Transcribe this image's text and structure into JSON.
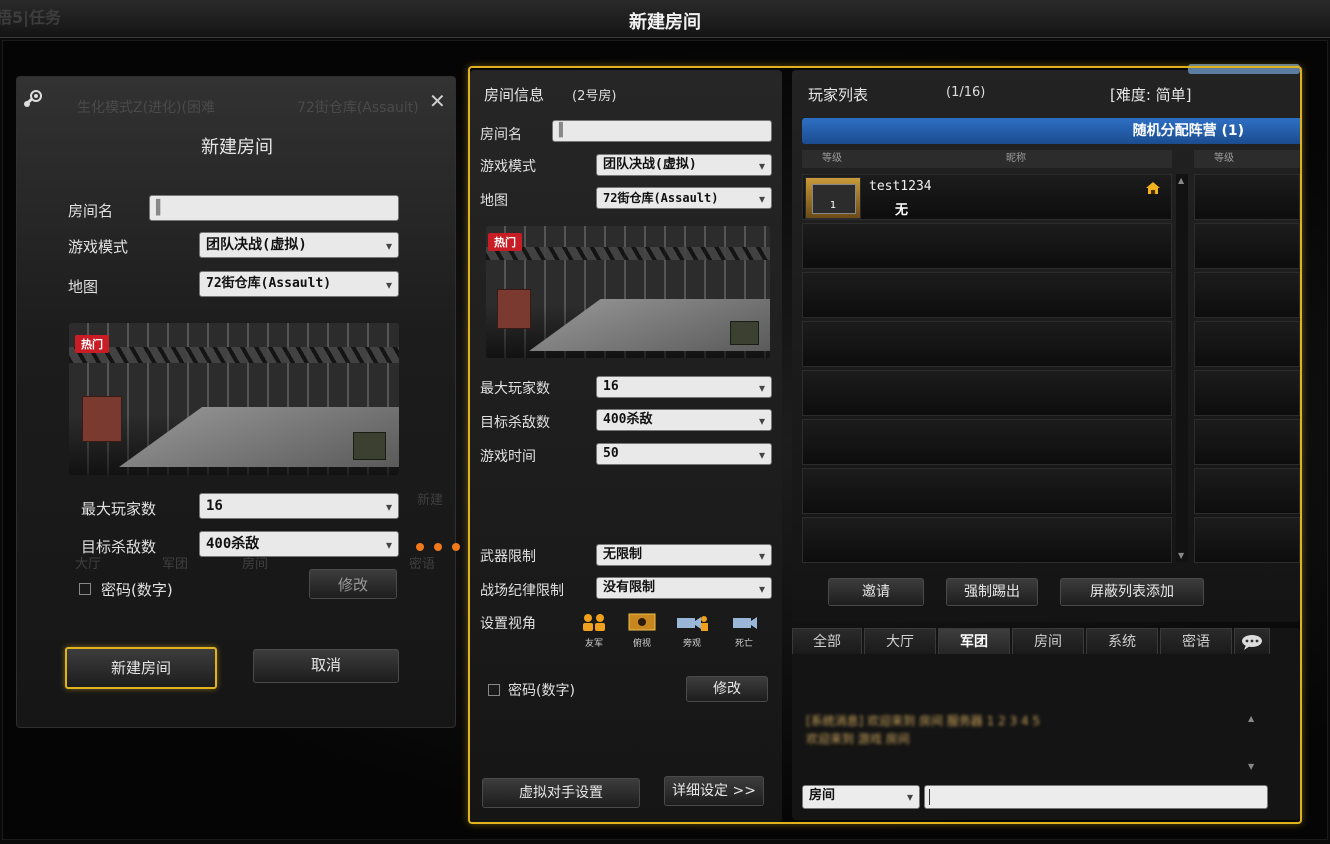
{
  "window": {
    "title": "新建房间",
    "ghost_left": "梧5|任务"
  },
  "dialog": {
    "ghost_mode": "生化模式Z(进化)(困难",
    "ghost_map": "72街仓库(Assault)",
    "title": "新建房间",
    "room_name_label": "房间名",
    "room_name_value": "▌",
    "mode_label": "游戏模式",
    "mode_value": "团队决战(虚拟)",
    "map_label": "地图",
    "map_value": "72街仓库(Assault)",
    "hot_badge": "热门",
    "max_players_label": "最大玩家数",
    "max_players_value": "16",
    "target_kills_label": "目标杀敌数",
    "target_kills_value": "400杀敌",
    "password_label": "密码(数字)",
    "modify_button": "修改",
    "create_button": "新建房间",
    "cancel_button": "取消",
    "ghost_tabs": [
      "大厅",
      "军团",
      "房间",
      "密语"
    ],
    "ghost_side": "新建"
  },
  "room_info": {
    "title": "房间信息",
    "room_no": "(2号房)",
    "room_name_label": "房间名",
    "room_name_value": "▌",
    "mode_label": "游戏模式",
    "mode_value": "团队决战(虚拟)",
    "map_label": "地图",
    "map_value": "72街仓库(Assault)",
    "hot_badge": "热门",
    "max_players_label": "最大玩家数",
    "max_players_value": "16",
    "target_kills_label": "目标杀敌数",
    "target_kills_value": "400杀敌",
    "game_time_label": "游戏时间",
    "game_time_value": "50",
    "weapon_limit_label": "武器限制",
    "weapon_limit_value": "无限制",
    "discipline_label": "战场纪律限制",
    "discipline_value": "没有限制",
    "view_label": "设置视角",
    "view_options": [
      "友军",
      "俯视",
      "旁观",
      "死亡"
    ],
    "password_label": "密码(数字)",
    "modify_button": "修改",
    "bot_settings_button": "虚拟对手设置",
    "detail_settings_button": "详细设定 >>"
  },
  "player_list": {
    "title": "玩家列表",
    "count": "(1/16)",
    "difficulty": "[难度: 简单]",
    "team_bar": "随机分配阵营 (1)",
    "col_level": "等级",
    "col_name": "昵称",
    "col_level2": "等级",
    "players": [
      {
        "name": "test1234",
        "clan": "无",
        "level": "1",
        "host": true
      }
    ],
    "empty_rows": 7,
    "invite_button": "邀请",
    "kick_button": "强制踢出",
    "block_button": "屏蔽列表添加"
  },
  "chat": {
    "tabs": [
      "全部",
      "大厅",
      "军团",
      "房间",
      "系统",
      "密语"
    ],
    "active_tab": "军团",
    "messages": [
      "[系统消息] 欢迎来到 房间 服务器 1 2 3 4 5",
      "欢迎来到 游戏 房间"
    ],
    "channel_value": "房间",
    "input_value": ""
  },
  "annotation": {
    "arrow_color": "#f07a1a"
  },
  "colors": {
    "highlight": "#e0b21e",
    "team_blue": "#2e6fc4",
    "hot_red": "#c81d25"
  }
}
